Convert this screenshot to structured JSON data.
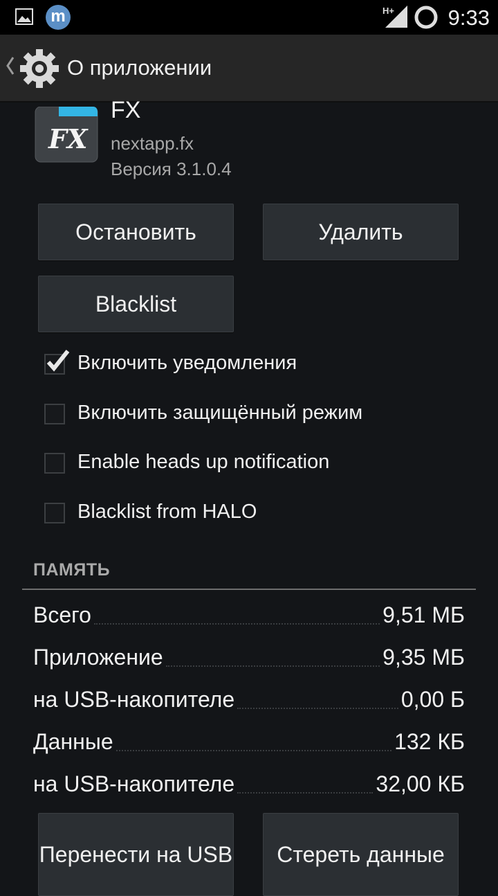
{
  "statusbar": {
    "time": "9:33",
    "notification_icons": [
      "gallery-icon",
      "m-app-icon"
    ],
    "m_app_letter": "m",
    "network": "H+",
    "indicators": [
      "signal-icon",
      "sync-ring-icon"
    ]
  },
  "actionbar": {
    "title": "О приложении",
    "icon": "settings-gear-icon"
  },
  "app": {
    "name": "FX",
    "package": "nextapp.fx",
    "version": "Версия 3.1.0.4",
    "icon_text": "FX"
  },
  "buttons": {
    "stop": "Остановить",
    "uninstall": "Удалить",
    "blacklist": "Blacklist",
    "move_to_usb": "Перенести на USB",
    "clear_data": "Стереть данные"
  },
  "checkboxes": [
    {
      "label": "Включить уведомления",
      "checked": true
    },
    {
      "label": "Включить защищённый режим",
      "checked": false
    },
    {
      "label": "Enable heads up notification",
      "checked": false
    },
    {
      "label": "Blacklist from HALO",
      "checked": false
    }
  ],
  "memory": {
    "title": "ПАМЯТЬ",
    "rows": [
      {
        "label": "Всего",
        "value": "9,51 МБ"
      },
      {
        "label": "Приложение",
        "value": "9,35 МБ"
      },
      {
        "label": "на USB-накопителе",
        "value": "0,00 Б"
      },
      {
        "label": "Данные",
        "value": "132 КБ"
      },
      {
        "label": "на USB-накопителе",
        "value": "32,00 КБ"
      }
    ]
  },
  "colors": {
    "background": "#131518",
    "actionbar": "#262626",
    "button": "#2b2f33",
    "accent_blue": "#33b5e5"
  }
}
